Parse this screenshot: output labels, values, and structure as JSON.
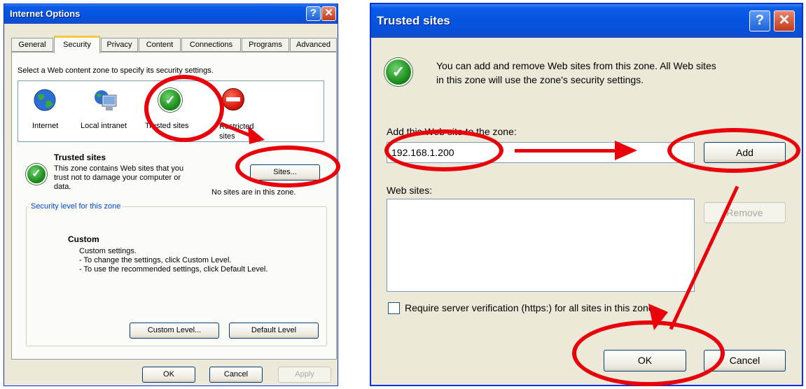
{
  "left_dialog": {
    "title": "Internet Options",
    "help_glyph": "?",
    "close_glyph": "✕",
    "tabs": [
      "General",
      "Security",
      "Privacy",
      "Content",
      "Connections",
      "Programs",
      "Advanced"
    ],
    "active_tab": "Security",
    "zone_prompt": "Select a Web content zone to specify its security settings.",
    "zones": [
      {
        "label": "Internet",
        "icon": "globe-icon"
      },
      {
        "label": "Local intranet",
        "icon": "computer-globe-icon"
      },
      {
        "label": "Trusted sites",
        "icon": "green-check-icon"
      },
      {
        "label": "Restricted sites",
        "icon": "no-entry-icon"
      }
    ],
    "zone_heading": "Trusted sites",
    "zone_desc_1": "This zone contains Web sites that you",
    "zone_desc_2": "trust not to damage your computer or",
    "zone_desc_3": "data.",
    "sites_button": "Sites...",
    "no_sites_text": "No sites are in this zone.",
    "security_group_label": "Security level for this zone",
    "custom_heading": "Custom",
    "custom_line_1": "Custom settings.",
    "custom_line_2": "- To change the settings, click Custom Level.",
    "custom_line_3": "- To use the recommended settings, click Default Level.",
    "custom_level_button": "Custom Level...",
    "default_level_button": "Default Level",
    "ok_button": "OK",
    "cancel_button": "Cancel",
    "apply_button": "Apply"
  },
  "right_dialog": {
    "title": "Trusted sites",
    "help_glyph": "?",
    "close_glyph": "✕",
    "info_1": "You can add and remove Web sites from this zone. All Web sites",
    "info_2": "in this zone will use the zone's security settings.",
    "add_label": "Add this Web site to the zone:",
    "url_value": "192.168.1.200",
    "add_button": "Add",
    "websites_label": "Web sites:",
    "remove_button": "Remove",
    "require_https": "Require server verification (https:) for all sites in this zone",
    "require_https_checked": false,
    "ok_button": "OK",
    "cancel_button": "Cancel"
  },
  "annotation_color": "#e8000b"
}
